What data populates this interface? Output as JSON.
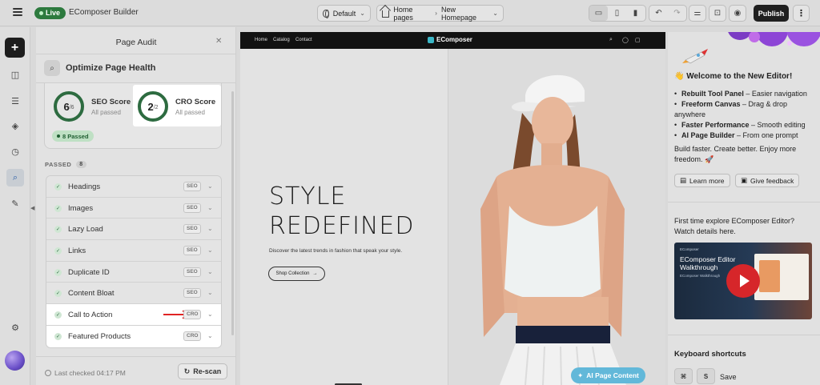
{
  "topbar": {
    "live_label": "Live",
    "app_title": "EComposer Builder",
    "theme_label": "Default",
    "breadcrumb_root": "Home pages",
    "breadcrumb_page": "New Homepage",
    "publish_label": "Publish",
    "devices": [
      "desktop-icon",
      "tablet-icon",
      "mobile-icon"
    ]
  },
  "rail": {
    "items": [
      "pages-icon",
      "sections-icon",
      "layers-icon",
      "history-icon",
      "page-audit-icon",
      "apps-icon"
    ],
    "active_item": "page-audit-icon",
    "settings_icon": "gear-icon"
  },
  "audit": {
    "panel_title": "Page Audit",
    "heading": "Optimize Page Health",
    "seo": {
      "score": "6",
      "total": "/6",
      "label": "SEO Score",
      "status": "All passed"
    },
    "cro": {
      "score": "2",
      "total": "/2",
      "label": "CRO Score",
      "status": "All passed"
    },
    "passed_chip": "8 Passed",
    "section_label": "PASSED",
    "section_count": "8",
    "checks": [
      {
        "label": "Headings",
        "tag": "SEO"
      },
      {
        "label": "Images",
        "tag": "SEO"
      },
      {
        "label": "Lazy Load",
        "tag": "SEO"
      },
      {
        "label": "Links",
        "tag": "SEO"
      },
      {
        "label": "Duplicate ID",
        "tag": "SEO"
      },
      {
        "label": "Content Bloat",
        "tag": "SEO"
      },
      {
        "label": "Call to Action",
        "tag": "CRO"
      },
      {
        "label": "Featured Products",
        "tag": "CRO"
      }
    ],
    "last_checked": "Last checked 04:17 PM",
    "rescan_label": "Re-scan"
  },
  "canvas": {
    "nav_links": [
      "Home",
      "Catalog",
      "Contact"
    ],
    "brand": "EComposer",
    "hero_line1": "STYLE",
    "hero_line2": "REDEFINED",
    "hero_sub": "Discover the latest trends in fashion that speak your style.",
    "shop_label": "Shop Collection",
    "ai_button": "AI Page Content"
  },
  "right": {
    "welcome": "👋 Welcome to the New Editor!",
    "features": [
      {
        "title": "Rebuilt Tool Panel",
        "desc": " – Easier navigation"
      },
      {
        "title": "Freeform Canvas",
        "desc": " – Drag & drop anywhere"
      },
      {
        "title": "Faster Performance",
        "desc": " – Smooth editing"
      },
      {
        "title": "AI Page Builder",
        "desc": " – From one prompt"
      }
    ],
    "tagline": "Build faster. Create better. Enjoy more freedom. 🚀",
    "learn_more": "Learn more",
    "give_feedback": "Give feedback",
    "first_time": "First time explore EComposer Editor? Watch details here.",
    "video": {
      "logo": "EComposer",
      "title_line1": "EComposer Editor",
      "title_line2": "Walkthrough",
      "subtitle": "EComposer Walkthrough"
    },
    "keyboard_title": "Keyboard shortcuts",
    "shortcut_keys": [
      "⌘",
      "S"
    ],
    "shortcut_label": "Save"
  }
}
